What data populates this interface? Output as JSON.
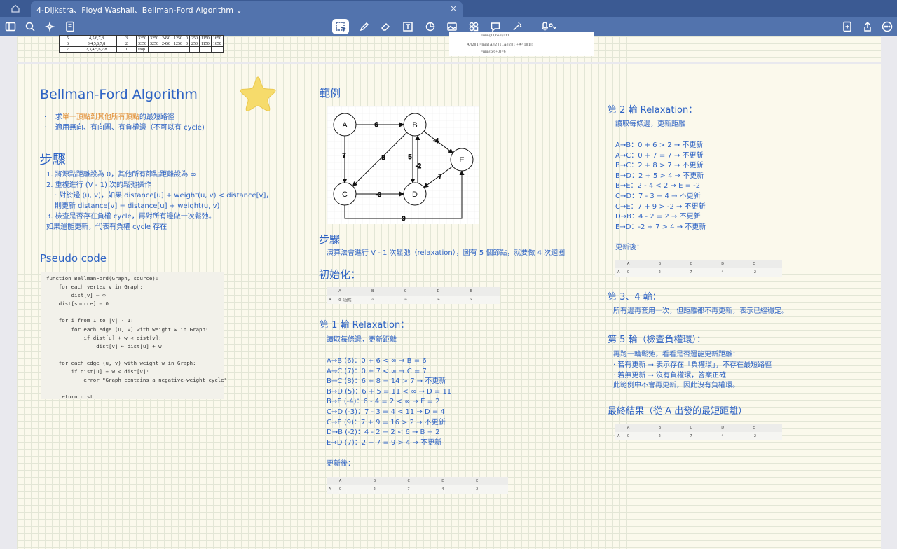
{
  "tab": {
    "title": "4-Dijkstra、Floyd Washall、Bellman-Ford Algorithm",
    "caret": "⌄",
    "close": "×"
  },
  "toolbar": {
    "icons": [
      "sidebar-icon",
      "search-icon",
      "sparkle-icon",
      "notes-icon",
      "lasso-icon",
      "pen-icon",
      "eraser-icon",
      "textbox-icon",
      "shapes-icon",
      "image-icon",
      "sticker-icon",
      "comment-icon",
      "magic-icon",
      "mic-icon",
      "add-page-icon",
      "share-icon",
      "more-icon"
    ]
  },
  "old_table": {
    "rows": [
      [
        "5",
        "4,5,6,7,8",
        "3",
        "3350",
        "3250",
        "2450",
        "1250",
        "0",
        "250",
        "1150",
        "1650"
      ],
      [
        "6",
        "3,4,5,6,7,8",
        "2",
        "3350",
        "3250",
        "2450",
        "1250",
        "0",
        "250",
        "1150",
        "1650"
      ],
      [
        "7",
        "2,3,4,5,6,7,8",
        "1",
        "stop",
        "",
        "",
        "",
        "",
        "",
        "",
        ""
      ]
    ]
  },
  "old_formula": {
    "l1": "=min{11,6+3}=11",
    "l2": "A³[2][1]=min{A²[2][1],A²[2][1]+A²[1][1]}",
    "l3": "=min{6,6+0}=6"
  },
  "col1": {
    "title": "Bellman-Ford Algorithm",
    "bullets_pre": [
      "求",
      "適用無向、有向圖、有負權邊（不可以有 cycle)"
    ],
    "bullet1_highlight": "單一頂點到其他所有頂點",
    "bullet1_post": "的最短路徑",
    "steps_title": "步驟",
    "steps": [
      "1.  將源點距離設為 0，其他所有節點距離設為 ∞",
      "2.  重複進行 (V - 1) 次的鬆弛操作",
      "    · 對於邊 (u, v)，如果 distance[u] + weight(u, v) < distance[v]，",
      "       則更新 distance[v] = distance[u] + weight(u, v)",
      "3.  檢查是否存在負權 cycle，再對所有邊做一次鬆弛。",
      "     如果還能更新，代表有負權 cycle 存在"
    ],
    "pseudo_title": "Pseudo code",
    "code": "function BellmanFord(Graph, source):\n    for each vertex v in Graph:\n        dist[v] ← ∞\n    dist[source] ← 0\n\n    for i from 1 to |V| - 1:\n        for each edge (u, v) with weight w in Graph:\n            if dist[u] + w < dist[v]:\n                dist[v] ← dist[u] + w\n\n    for each edge (u, v) with weight w in Graph:\n        if dist[u] + w < dist[v]:\n            error \"Graph contains a negative-weight cycle\"\n\n    return dist"
  },
  "col2": {
    "example_title": "範例",
    "graph": {
      "nodes": [
        "A",
        "B",
        "C",
        "D",
        "E"
      ],
      "weights": [
        "6",
        "7",
        "8",
        "5",
        "-2",
        "-4",
        "-3",
        "7",
        "9"
      ]
    },
    "steps_title": "步驟",
    "steps_text": "演算法會進行 V - 1 次鬆弛（relaxation），圖有 5 個節點，就要做 4 次迴圈",
    "init_title": "初始化：",
    "init_table": [
      [
        "",
        "A",
        "B",
        "C",
        "D",
        "E"
      ],
      [
        "A",
        "0（起點）",
        "∞",
        "∞",
        "∞",
        "∞"
      ]
    ],
    "round1_title": "第 1 輪 Relaxation：",
    "round1_intro": "讀取每條邊，更新距離",
    "round1_lines": [
      "A→B (6)：0 + 6 < ∞ → B = 6",
      "A→C (7)：0 + 7 < ∞ → C = 7",
      "B→C (8)：6 + 8 = 14 > 7 → 不更新",
      "B→D (5)：6 + 5 = 11 < ∞ → D = 11",
      "B→E (-4)：6 - 4 = 2 < ∞ → E = 2",
      "C→D (-3)：7 - 3 = 4 < 11 → D = 4",
      "C→E (9)：7 + 9 = 16 > 2 → 不更新",
      "D→B (-2)：4 - 2 = 2 < 6 → B = 2",
      "E→D (7)：2 + 7 = 9 > 4 → 不更新"
    ],
    "round1_after": "更新後：",
    "round1_table": [
      [
        "",
        "A",
        "B",
        "C",
        "D",
        "E"
      ],
      [
        "A",
        "0",
        "2",
        "7",
        "4",
        "2"
      ]
    ]
  },
  "col3": {
    "round2_title": "第 2 輪 Relaxation：",
    "round2_intro": "讀取每條邊，更新距離",
    "round2_lines": [
      "A→B：0 + 6 > 2 → 不更新",
      "A→C：0 + 7 = 7 → 不更新",
      "B→C：2 + 8 > 7 → 不更新",
      "B→D：2 + 5 > 4 → 不更新",
      "B→E：2 - 4 < 2 → E = -2",
      "C→D：7 - 3 = 4 → 不更新",
      "C→E：7 + 9 > -2 → 不更新",
      "D→B：4 - 2 = 2 → 不更新",
      "E→D：-2 + 7 > 4 → 不更新"
    ],
    "round2_after": "更新後：",
    "round2_table": [
      [
        "",
        "A",
        "B",
        "C",
        "D",
        "E"
      ],
      [
        "A",
        "0",
        "2",
        "7",
        "4",
        "-2"
      ]
    ],
    "round34_title": "第 3、4 輪：",
    "round34_text": "所有邊再套用一次，但距離都不再更新，表示已經穩定。",
    "round5_title": "第 5 輪（檢查負權環）：",
    "round5_lines": [
      "再跑一輪鬆弛，看看是否還能更新距離：",
      "  · 若有更新 → 表示存在「負權環」，不存在最短路徑",
      "  · 若無更新 → 沒有負權環，答案正確",
      "此範例中不會再更新，因此沒有負權環。"
    ],
    "final_title": "最終結果（從 A 出發的最短距離）",
    "final_table": [
      [
        "",
        "A",
        "B",
        "C",
        "D",
        "E"
      ],
      [
        "A",
        "0",
        "2",
        "7",
        "4",
        "-2"
      ]
    ]
  }
}
